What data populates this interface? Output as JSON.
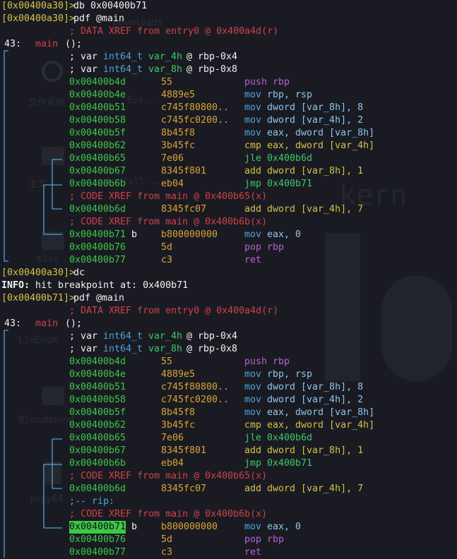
{
  "background_watermark": {
    "items": [
      "文件系统",
      "misc",
      "LinEnum",
      "BloodHound",
      "pspy64",
      "Downloads",
      "Eve...",
      "Install...",
      "主文"
    ]
  },
  "session1": {
    "prompt1": "[0x00400a30]>",
    "cmd1": "db 0x00400b71",
    "prompt2": "[0x00400a30]>",
    "cmd2": "pdf @main",
    "xref": "; DATA XREF from entry0 @ 0x400a4d(r)",
    "func_size": "43:",
    "func_name": "main",
    "func_sig": "();",
    "var1_prefix": "; var",
    "var1_type": "int64_t",
    "var1_name": "var_4h",
    "var1_loc": "@ rbp-0x4",
    "var2_prefix": "; var",
    "var2_type": "int64_t",
    "var2_name": "var_8h",
    "var2_loc": "@ rbp-0x8"
  },
  "instructions1": [
    {
      "addr": "0x00400b4d",
      "bytes": "55",
      "op": "push",
      "args": "rbp"
    },
    {
      "addr": "0x00400b4e",
      "bytes": "4889e5",
      "op": "mov",
      "args": "rbp, rsp"
    },
    {
      "addr": "0x00400b51",
      "bytes": "c745f80800..",
      "op": "mov",
      "args": "dword [var_8h], 8"
    },
    {
      "addr": "0x00400b58",
      "bytes": "c745fc0200..",
      "op": "mov",
      "args": "dword [var_4h], 2"
    },
    {
      "addr": "0x00400b5f",
      "bytes": "8b45f8",
      "op": "mov",
      "args": "eax, dword [var_8h]"
    },
    {
      "addr": "0x00400b62",
      "bytes": "3b45fc",
      "op": "cmp",
      "args": "eax, dword [var_4h]"
    },
    {
      "addr": "0x00400b65",
      "bytes": "7e06",
      "op": "jle",
      "args": "0x400b6d"
    },
    {
      "addr": "0x00400b67",
      "bytes": "8345f801",
      "op": "add",
      "args": "dword [var_8h], 1"
    },
    {
      "addr": "0x00400b6b",
      "bytes": "eb04",
      "op": "jmp",
      "args": "0x400b71"
    },
    {
      "xref": "; CODE XREF from main @ 0x400b65(x)"
    },
    {
      "addr": "0x00400b6d",
      "bytes": "8345fc07",
      "op": "add",
      "args": "dword [var_4h], 7"
    },
    {
      "xref": "; CODE XREF from main @ 0x400b6b(x)"
    },
    {
      "addr": "0x00400b71",
      "flag": "b",
      "bytes": "b800000000",
      "op": "mov",
      "args": "eax, 0"
    },
    {
      "addr": "0x00400b76",
      "bytes": "5d",
      "op": "pop",
      "args": "rbp"
    },
    {
      "addr": "0x00400b77",
      "bytes": "c3",
      "op": "ret",
      "args": ""
    }
  ],
  "mid": {
    "prompt3": "[0x00400a30]>",
    "cmd3": "dc",
    "info_label": "INFO:",
    "info_text": "hit breakpoint at: 0x400b71",
    "prompt4": "[0x00400b71]>",
    "cmd4": "pdf @main"
  },
  "session2": {
    "xref": "; DATA XREF from entry0 @ 0x400a4d(r)",
    "func_size": "43:",
    "func_name": "main",
    "func_sig": "();",
    "var1_prefix": "; var",
    "var1_type": "int64_t",
    "var1_name": "var_4h",
    "var1_loc": "@ rbp-0x4",
    "var2_prefix": "; var",
    "var2_type": "int64_t",
    "var2_name": "var_8h",
    "var2_loc": "@ rbp-0x8",
    "rip_comment": ";-- rip:"
  },
  "instructions2": [
    {
      "addr": "0x00400b4d",
      "bytes": "55",
      "op": "push",
      "args": "rbp"
    },
    {
      "addr": "0x00400b4e",
      "bytes": "4889e5",
      "op": "mov",
      "args": "rbp, rsp"
    },
    {
      "addr": "0x00400b51",
      "bytes": "c745f80800..",
      "op": "mov",
      "args": "dword [var_8h], 8"
    },
    {
      "addr": "0x00400b58",
      "bytes": "c745fc0200..",
      "op": "mov",
      "args": "dword [var_4h], 2"
    },
    {
      "addr": "0x00400b5f",
      "bytes": "8b45f8",
      "op": "mov",
      "args": "eax, dword [var_8h]"
    },
    {
      "addr": "0x00400b62",
      "bytes": "3b45fc",
      "op": "cmp",
      "args": "eax, dword [var_4h]"
    },
    {
      "addr": "0x00400b65",
      "bytes": "7e06",
      "op": "jle",
      "args": "0x400b6d"
    },
    {
      "addr": "0x00400b67",
      "bytes": "8345f801",
      "op": "add",
      "args": "dword [var_8h], 1"
    },
    {
      "addr": "0x00400b6b",
      "bytes": "eb04",
      "op": "jmp",
      "args": "0x400b71"
    },
    {
      "xref": "; CODE XREF from main @ 0x400b65(x)"
    },
    {
      "addr": "0x00400b6d",
      "bytes": "8345fc07",
      "op": "add",
      "args": "dword [var_4h], 7"
    },
    {
      "rip": ";-- rip:"
    },
    {
      "xref": "; CODE XREF from main @ 0x400b6b(x)"
    },
    {
      "addr": "0x00400b71",
      "flag": "b",
      "bytes": "b800000000",
      "op": "mov",
      "args": "eax, 0",
      "highlight": true
    },
    {
      "addr": "0x00400b76",
      "bytes": "5d",
      "op": "pop",
      "args": "rbp"
    },
    {
      "addr": "0x00400b77",
      "bytes": "c3",
      "op": "ret",
      "args": ""
    }
  ],
  "colors": {
    "background": "#1a1b22",
    "prompt": "#d8c34a",
    "address": "#3ec74a",
    "bytes": "#d9a437",
    "comment": "#d0404a",
    "arrow": "#4ea1d8",
    "rip_highlight": "#3ec74a"
  }
}
